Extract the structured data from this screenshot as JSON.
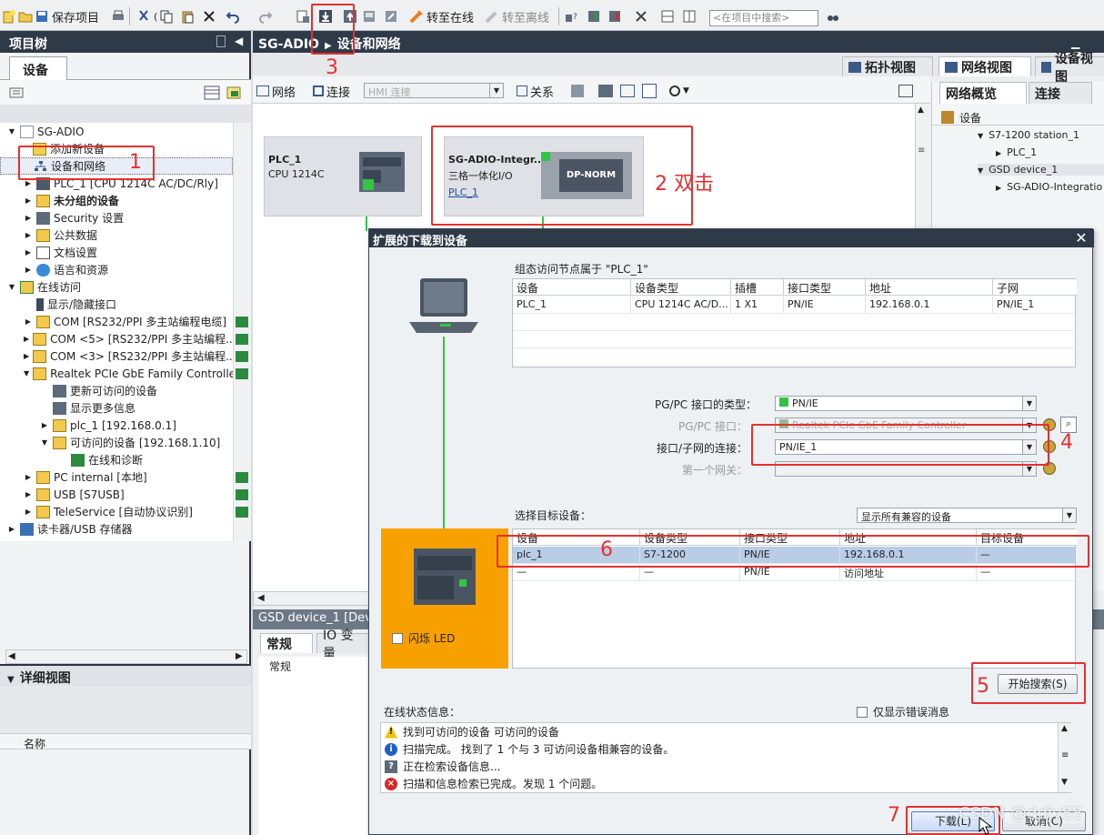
{
  "toolbar": {
    "save_project": "保存项目",
    "go_online": "转至在线",
    "go_offline": "转至离线",
    "search_placeholder": "<在项目中搜索>"
  },
  "project_tree": {
    "header": "项目树",
    "tab": "设备",
    "items": [
      {
        "label": "SG-ADIO"
      },
      {
        "label": "添加新设备"
      },
      {
        "label": "设备和网络"
      },
      {
        "label": "PLC_1 [CPU 1214C AC/DC/Rly]"
      },
      {
        "label": "未分组的设备"
      },
      {
        "label": "Security 设置"
      },
      {
        "label": "公共数据"
      },
      {
        "label": "文档设置"
      },
      {
        "label": "语言和资源"
      },
      {
        "label": "在线访问"
      },
      {
        "label": "显示/隐藏接口"
      },
      {
        "label": "COM [RS232/PPI 多主站编程电缆]"
      },
      {
        "label": "COM <5> [RS232/PPI 多主站编程..."
      },
      {
        "label": "COM <3> [RS232/PPI 多主站编程..."
      },
      {
        "label": "Realtek PCIe GbE Family Controller"
      },
      {
        "label": "更新可访问的设备"
      },
      {
        "label": "显示更多信息"
      },
      {
        "label": "plc_1 [192.168.0.1]"
      },
      {
        "label": "可访问的设备 [192.168.1.10]"
      },
      {
        "label": "在线和诊断"
      },
      {
        "label": "PC internal [本地]"
      },
      {
        "label": "USB [S7USB]"
      },
      {
        "label": "TeleService [自动协议识别]"
      },
      {
        "label": "读卡器/USB 存储器"
      }
    ],
    "detail_header": "详细视图",
    "detail_col": "名称"
  },
  "editor": {
    "breadcrumb_root": "SG-ADIO",
    "breadcrumb_page": "设备和网络",
    "view_tabs": {
      "topology": "拓扑视图",
      "network": "网络视图",
      "device": "设备视图"
    },
    "canvas_toolbar": {
      "network": "网络",
      "connect": "连接",
      "hmi_connection": "HMI 连接",
      "relations": "关系"
    },
    "devices": {
      "plc_name": "PLC_1",
      "plc_cpu": "CPU 1214C",
      "gsd_name": "SG-ADIO-Integr...",
      "gsd_desc": "三格一体化I/O",
      "gsd_link": "PLC_1",
      "dp_norm": "DP-NORM"
    },
    "overview_tabs": {
      "network_overview": "网络概览",
      "connection": "连接"
    },
    "overview_header": "设备",
    "overview_items": [
      "S7-1200 station_1",
      "PLC_1",
      "GSD device_1",
      "SG-ADIO-Integratio"
    ],
    "bottom": {
      "title": "GSD device_1 [Dev",
      "tab_general": "常规",
      "tab_io": "IO 变量",
      "general_label": "常规"
    }
  },
  "dialog": {
    "title": "扩展的下载到设备",
    "config_access_node": "组态访问节点属于 \"PLC_1\"",
    "config_headers": [
      "设备",
      "设备类型",
      "插槽",
      "接口类型",
      "地址",
      "子网"
    ],
    "config_rows": [
      [
        "PLC_1",
        "CPU 1214C AC/D...",
        "1 X1",
        "PN/IE",
        "192.168.0.1",
        "PN/IE_1"
      ]
    ],
    "pgpc_if_type_label": "PG/PC 接口的类型：",
    "pgpc_if_type_value": "PN/IE",
    "pgpc_if_label": "PG/PC 接口：",
    "pgpc_if_value": "Realtek PCIe GbE Family Controller",
    "if_subnet_label": "接口/子网的连接：",
    "if_subnet_value": "PN/IE_1",
    "first_gateway_label": "第一个网关：",
    "select_target_label": "选择目标设备：",
    "show_option": "显示所有兼容的设备",
    "target_headers": [
      "设备",
      "设备类型",
      "接口类型",
      "地址",
      "目标设备"
    ],
    "target_rows": [
      [
        "plc_1",
        "S7-1200",
        "PN/IE",
        "192.168.0.1",
        "—"
      ],
      [
        "—",
        "—",
        "PN/IE",
        "访问地址",
        "—"
      ]
    ],
    "flash_led": "闪烁 LED",
    "start_search": "开始搜索(S)",
    "online_status_label": "在线状态信息：",
    "only_errors": "仅显示错误消息",
    "status_messages": [
      {
        "type": "warning",
        "text": "找到可访问的设备 可访问的设备"
      },
      {
        "type": "info",
        "text": "扫描完成。 找到了 1 个与 3 可访问设备相兼容的设备。"
      },
      {
        "type": "progress",
        "text": "正在检索设备信息..."
      },
      {
        "type": "error",
        "text": "扫描和信息检索已完成。发现 1 个问题。"
      }
    ],
    "download_button": "下载(L)",
    "cancel_button": "取消(C)"
  },
  "annotations": {
    "n1": "1",
    "n2": "2 双击",
    "n3": "3",
    "n4": "4",
    "n5": "5",
    "n6": "6",
    "n7": "7"
  },
  "watermark": "CSDN @ddjy88",
  "colors": {
    "annotation": "#e53030",
    "title_bar": "#2e3a48",
    "selection": "#b9cde6",
    "device_panel": "#f7a000",
    "network_line": "#33c444"
  }
}
